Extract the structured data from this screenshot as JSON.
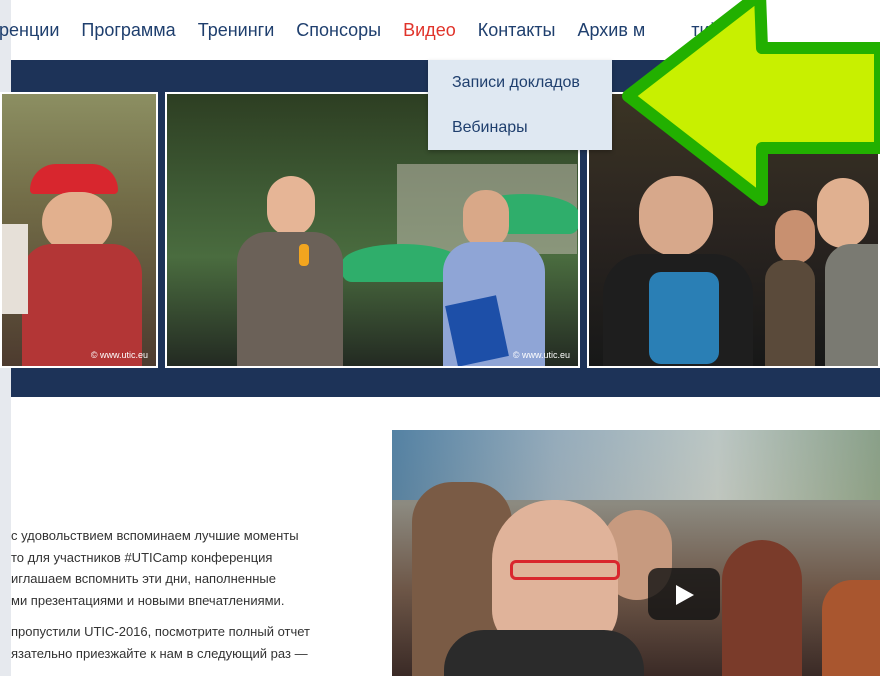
{
  "nav": {
    "items": [
      "ренции",
      "Программа",
      "Тренинги",
      "Спонсоры",
      "Видео",
      "Контакты",
      "Архив м",
      "тий"
    ],
    "active_index": 4
  },
  "dropdown": {
    "items": [
      "Записи докладов",
      "Вебинары"
    ]
  },
  "photos": {
    "watermark": "© www.utic.eu"
  },
  "article": {
    "paragraph1": [
      "с удовольствием вспоминаем лучшие моменты",
      "то для участников #UTICamp конференция",
      "иглашаем вспомнить эти дни, наполненные",
      "ми презентациями и новыми впечатлениями."
    ],
    "paragraph2": [
      "пропустили UTIC-2016, посмотрите полный отчет",
      "язательно приезжайте к нам в следующий раз —"
    ]
  },
  "colors": {
    "nav_text": "#1f3f6e",
    "nav_active": "#e0332a",
    "band": "#1d3358",
    "arrow_fill": "#c8f000",
    "arrow_stroke": "#22b000"
  },
  "icons": {
    "play": "play-icon",
    "annotation": "arrow-left-icon"
  }
}
